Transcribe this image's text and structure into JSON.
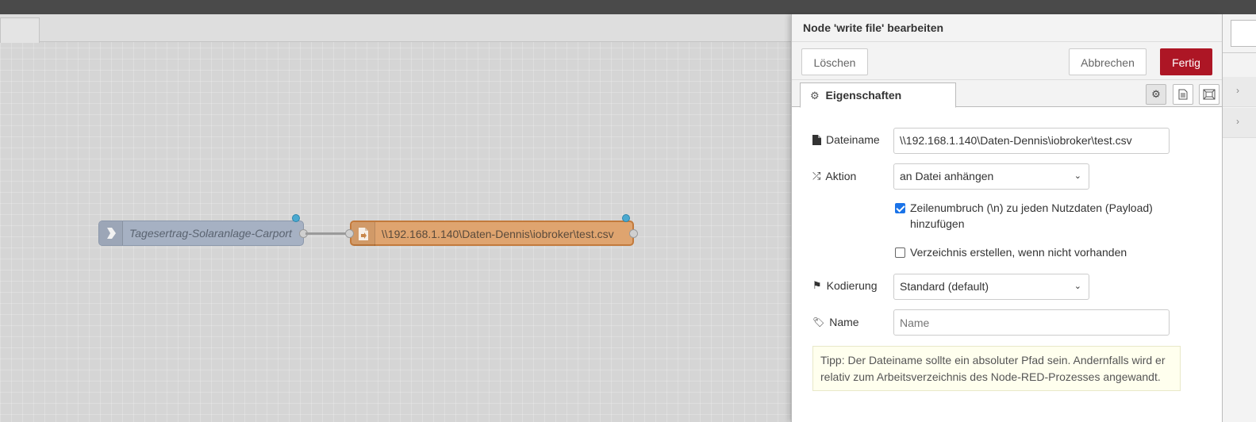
{
  "workspace": {
    "nodes": {
      "link_in": {
        "label": "Tagesertrag-Solaranlage-Carport",
        "color": "#a6b1c3"
      },
      "write_file": {
        "label": "\\\\192.168.1.140\\Daten-Dennis\\iobroker\\test.csv",
        "color": "#dfa46f"
      }
    }
  },
  "tray": {
    "title": "Node 'write file' bearbeiten",
    "buttons": {
      "delete": "Löschen",
      "cancel": "Abbrechen",
      "done": "Fertig"
    },
    "tabs": {
      "properties": "Eigenschaften"
    },
    "form": {
      "filename": {
        "label": "Dateiname",
        "value": "\\\\192.168.1.140\\Daten-Dennis\\iobroker\\test.csv"
      },
      "action": {
        "label": "Aktion",
        "value": "an Datei anhängen"
      },
      "newline": {
        "label_line1": "Zeilenumbruch (\\n) zu jeden Nutzdaten (Payload)",
        "label_line2": "hinzufügen",
        "checked": true
      },
      "create_dir": {
        "label": "Verzeichnis erstellen, wenn nicht vorhanden",
        "checked": false
      },
      "encoding": {
        "label": "Kodierung",
        "value": "Standard (default)"
      },
      "name": {
        "label": "Name",
        "placeholder": "Name"
      }
    },
    "tip": "Tipp: Der Dateiname sollte ein absoluter Pfad sein. Andernfalls wird er relativ zum Arbeitsverzeichnis des Node-RED-Prozesses angewandt."
  },
  "colors": {
    "done_button": "#ad1625",
    "changed_indicator": "#4aa9d0"
  }
}
